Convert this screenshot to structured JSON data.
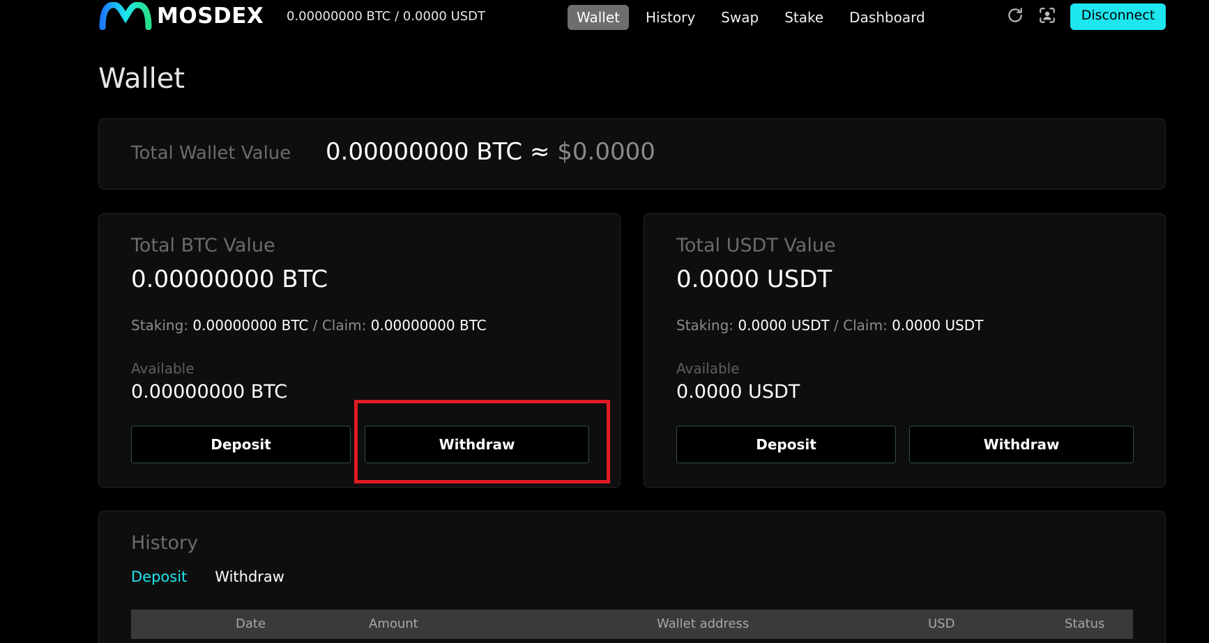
{
  "app": {
    "brand": "MOSDEX",
    "balance_summary": "0.00000000 BTC / 0.0000 USDT",
    "accent_color": "#1ee6ee",
    "highlight_color": "#e01b24"
  },
  "nav": {
    "items": [
      {
        "label": "Wallet",
        "active": true
      },
      {
        "label": "History",
        "active": false
      },
      {
        "label": "Swap",
        "active": false
      },
      {
        "label": "Stake",
        "active": false
      },
      {
        "label": "Dashboard",
        "active": false
      }
    ],
    "icons": [
      "refresh-icon",
      "user-scan-icon"
    ],
    "disconnect_label": "Disconnect"
  },
  "page": {
    "title": "Wallet"
  },
  "total": {
    "label": "Total Wallet Value",
    "btc_value": "0.00000000 BTC",
    "approx": " ≈ ",
    "usd_value": "$0.0000"
  },
  "btc": {
    "title": "Total BTC Value",
    "amount": "0.00000000 BTC",
    "staking_label": "Staking: ",
    "staking_value": "0.00000000 BTC",
    "separator": " / ",
    "claim_label": "Claim: ",
    "claim_value": "0.00000000 BTC",
    "available_label": "Available",
    "available_value": "0.00000000 BTC",
    "deposit_label": "Deposit",
    "withdraw_label": "Withdraw"
  },
  "usdt": {
    "title": "Total USDT Value",
    "amount": "0.0000 USDT",
    "staking_label": "Staking: ",
    "staking_value": "0.0000 USDT",
    "separator": " / ",
    "claim_label": "Claim: ",
    "claim_value": "0.0000 USDT",
    "available_label": "Available",
    "available_value": "0.0000 USDT",
    "deposit_label": "Deposit",
    "withdraw_label": "Withdraw"
  },
  "history": {
    "title": "History",
    "tabs": [
      {
        "label": "Deposit",
        "active": true
      },
      {
        "label": "Withdraw",
        "active": false
      }
    ],
    "columns": [
      "Date",
      "Amount",
      "Wallet address",
      "USD",
      "Status"
    ]
  }
}
